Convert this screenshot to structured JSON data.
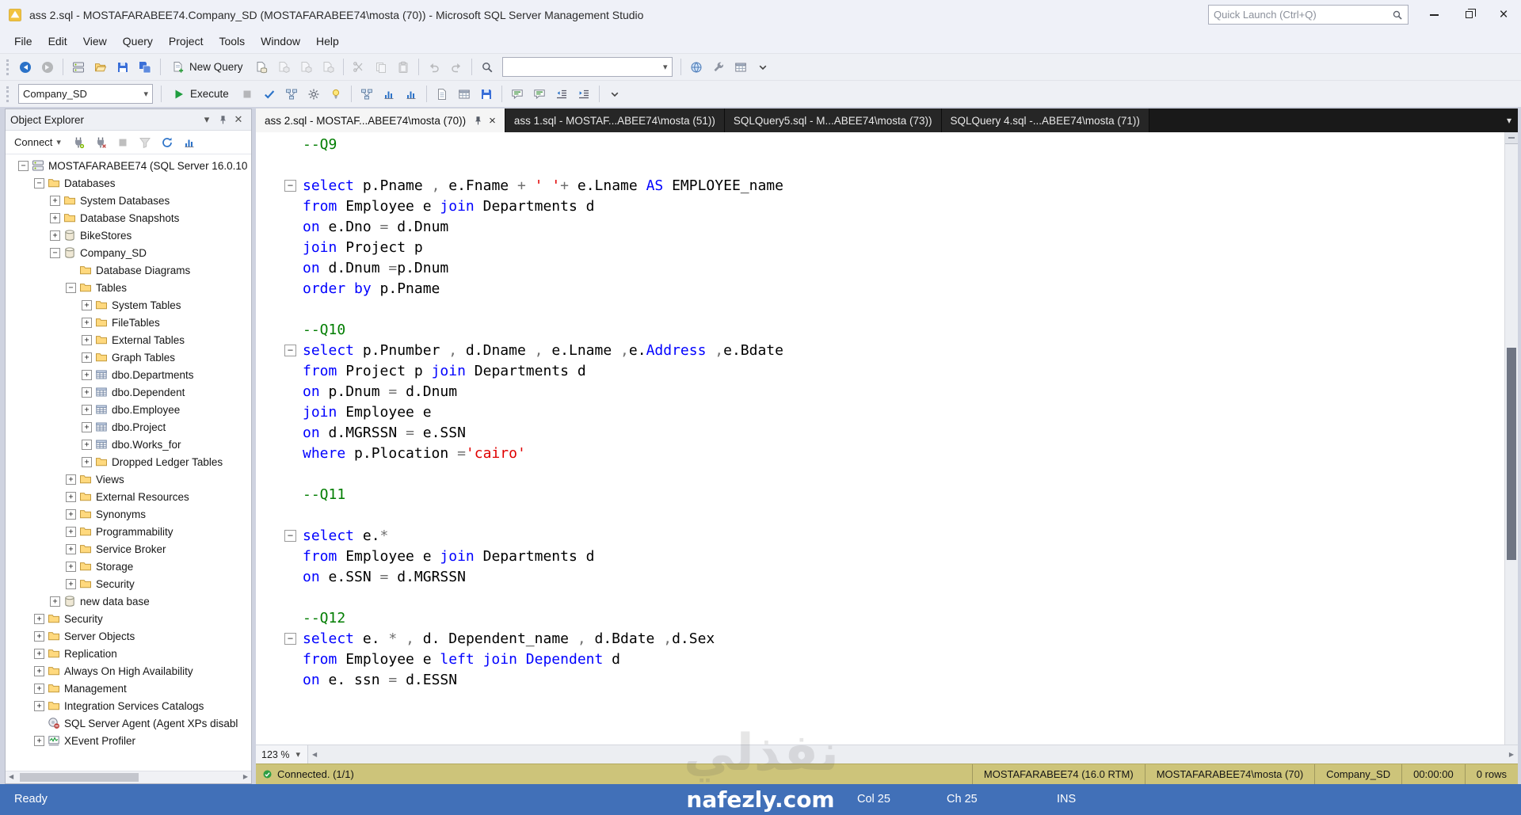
{
  "titlebar": {
    "title": "ass 2.sql - MOSTAFARABEE74.Company_SD (MOSTAFARABEE74\\mosta (70)) - Microsoft SQL Server Management Studio",
    "quick_launch_placeholder": "Quick Launch (Ctrl+Q)"
  },
  "menubar": {
    "items": [
      "File",
      "Edit",
      "View",
      "Query",
      "Project",
      "Tools",
      "Window",
      "Help"
    ]
  },
  "standard_toolbar": {
    "new_query_label": "New Query",
    "items": [
      {
        "t": "i",
        "name": "back-button",
        "icon": "arrow-left-icon",
        "enabled": true
      },
      {
        "t": "i",
        "name": "forward-button",
        "icon": "arrow-right-icon",
        "enabled": false
      },
      {
        "t": "sep"
      },
      {
        "t": "i",
        "name": "manage-connections-icon",
        "icon": "server-icon",
        "enabled": true
      },
      {
        "t": "i",
        "name": "open-file-icon",
        "icon": "folder-open-icon",
        "enabled": true
      },
      {
        "t": "i",
        "name": "save-icon",
        "icon": "floppy-icon",
        "enabled": true
      },
      {
        "t": "i",
        "name": "save-all-icon",
        "icon": "floppy-all-icon",
        "enabled": true
      },
      {
        "t": "sep"
      },
      {
        "t": "btn",
        "name": "new-query-button",
        "icon": "page-plus-icon",
        "labelKey": "new_query_label"
      },
      {
        "t": "i",
        "name": "new-database-engine-query-icon",
        "icon": "page-db-icon",
        "enabled": true
      },
      {
        "t": "i",
        "name": "new-analysis-query-icon",
        "icon": "page-cube-icon",
        "enabled": false
      },
      {
        "t": "i",
        "name": "new-dmx-query-icon",
        "icon": "page-cube-icon",
        "enabled": false
      },
      {
        "t": "i",
        "name": "new-xmla-query-icon",
        "icon": "page-cube-icon",
        "enabled": false
      },
      {
        "t": "sep"
      },
      {
        "t": "i",
        "name": "cut-icon",
        "icon": "scissors-icon",
        "enabled": false
      },
      {
        "t": "i",
        "name": "copy-icon",
        "icon": "copy-icon",
        "enabled": false
      },
      {
        "t": "i",
        "name": "paste-icon",
        "icon": "clipboard-icon",
        "enabled": false
      },
      {
        "t": "sep"
      },
      {
        "t": "i",
        "name": "undo-icon",
        "icon": "undo-icon",
        "enabled": false
      },
      {
        "t": "i",
        "name": "redo-icon",
        "icon": "redo-icon",
        "enabled": false
      },
      {
        "t": "sep"
      },
      {
        "t": "i",
        "name": "find-icon",
        "icon": "magnifier-icon",
        "enabled": true
      },
      {
        "t": "combo",
        "name": "find-combobox",
        "value": ""
      },
      {
        "t": "sep"
      },
      {
        "t": "i",
        "name": "web-browser-icon",
        "icon": "globe-icon",
        "enabled": true
      },
      {
        "t": "i",
        "name": "properties-window-icon",
        "icon": "wrench-icon",
        "enabled": true
      },
      {
        "t": "i",
        "name": "template-explorer-icon",
        "icon": "grid-icon",
        "enabled": true
      },
      {
        "t": "i",
        "name": "toolbar-overflow-chevron",
        "icon": "chevron-down-icon",
        "enabled": true
      }
    ]
  },
  "sql_toolbar": {
    "database_selector_value": "Company_SD",
    "execute_label": "Execute",
    "items": [
      {
        "t": "dbcombo",
        "name": "database-selector"
      },
      {
        "t": "sep"
      },
      {
        "t": "exec",
        "name": "execute-button"
      },
      {
        "t": "i",
        "name": "cancel-query-icon",
        "icon": "stop-icon",
        "enabled": false
      },
      {
        "t": "i",
        "name": "parse-query-icon",
        "icon": "check-icon",
        "enabled": true
      },
      {
        "t": "i",
        "name": "estimated-plan-icon",
        "icon": "plan-icon",
        "enabled": true
      },
      {
        "t": "i",
        "name": "query-options-icon",
        "icon": "gear-icon",
        "enabled": true
      },
      {
        "t": "i",
        "name": "intellisense-icon",
        "icon": "bulb-icon",
        "enabled": true
      },
      {
        "t": "sep"
      },
      {
        "t": "i",
        "name": "actual-plan-icon",
        "icon": "plan-icon",
        "enabled": true
      },
      {
        "t": "i",
        "name": "live-query-stats-icon",
        "icon": "chart-icon",
        "enabled": true
      },
      {
        "t": "i",
        "name": "client-stats-icon",
        "icon": "chart-icon",
        "enabled": true
      },
      {
        "t": "sep"
      },
      {
        "t": "i",
        "name": "results-to-text-icon",
        "icon": "page-icon",
        "enabled": true
      },
      {
        "t": "i",
        "name": "results-to-grid-icon",
        "icon": "grid-icon",
        "enabled": true
      },
      {
        "t": "i",
        "name": "results-to-file-icon",
        "icon": "floppy-icon",
        "enabled": true
      },
      {
        "t": "sep"
      },
      {
        "t": "i",
        "name": "comment-selection-icon",
        "icon": "comment-icon",
        "enabled": true
      },
      {
        "t": "i",
        "name": "uncomment-selection-icon",
        "icon": "comment-icon",
        "enabled": true
      },
      {
        "t": "i",
        "name": "decrease-indent-icon",
        "icon": "indent-dec-icon",
        "enabled": true
      },
      {
        "t": "i",
        "name": "increase-indent-icon",
        "icon": "indent-inc-icon",
        "enabled": true
      },
      {
        "t": "sep"
      },
      {
        "t": "i",
        "name": "toolbar-overflow-chevron",
        "icon": "chevron-down-icon",
        "enabled": true
      }
    ]
  },
  "tab_strip": {
    "tabs": [
      {
        "label": "ass 2.sql - MOSTAF...ABEE74\\mosta (70))",
        "active": true
      },
      {
        "label": "ass 1.sql - MOSTAF...ABEE74\\mosta (51))",
        "active": false
      },
      {
        "label": "SQLQuery5.sql - M...ABEE74\\mosta (73))",
        "active": false
      },
      {
        "label": "SQLQuery 4.sql -...ABEE74\\mosta (71))",
        "active": false
      }
    ]
  },
  "object_explorer": {
    "title": "Object Explorer",
    "connect_label": "Connect",
    "toolbar_icons": [
      {
        "name": "connect-server-icon",
        "icon": "plug-icon",
        "enabled": true
      },
      {
        "name": "disconnect-server-icon",
        "icon": "plug-x-icon",
        "enabled": true
      },
      {
        "name": "stop-icon",
        "icon": "stop-icon",
        "enabled": false
      },
      {
        "name": "filter-icon",
        "icon": "funnel-icon",
        "enabled": false
      },
      {
        "name": "refresh-icon",
        "icon": "refresh-icon",
        "enabled": true
      },
      {
        "name": "activity-monitor-icon",
        "icon": "chart-icon",
        "enabled": true
      }
    ],
    "tree": [
      {
        "label": "MOSTAFARABEE74 (SQL Server 16.0.10",
        "level": 0,
        "exp": "minus",
        "icon": "server"
      },
      {
        "label": "Databases",
        "level": 1,
        "exp": "minus",
        "icon": "folder"
      },
      {
        "label": "System Databases",
        "level": 2,
        "exp": "plus",
        "icon": "folder"
      },
      {
        "label": "Database Snapshots",
        "level": 2,
        "exp": "plus",
        "icon": "folder"
      },
      {
        "label": "BikeStores",
        "level": 2,
        "exp": "plus",
        "icon": "database"
      },
      {
        "label": "Company_SD",
        "level": 2,
        "exp": "minus",
        "icon": "database"
      },
      {
        "label": "Database Diagrams",
        "level": 3,
        "exp": "none",
        "icon": "folder"
      },
      {
        "label": "Tables",
        "level": 3,
        "exp": "minus",
        "icon": "folder"
      },
      {
        "label": "System Tables",
        "level": 4,
        "exp": "plus",
        "icon": "folder"
      },
      {
        "label": "FileTables",
        "level": 4,
        "exp": "plus",
        "icon": "folder"
      },
      {
        "label": "External Tables",
        "level": 4,
        "exp": "plus",
        "icon": "folder"
      },
      {
        "label": "Graph Tables",
        "level": 4,
        "exp": "plus",
        "icon": "folder"
      },
      {
        "label": "dbo.Departments",
        "level": 4,
        "exp": "plus",
        "icon": "table"
      },
      {
        "label": "dbo.Dependent",
        "level": 4,
        "exp": "plus",
        "icon": "table"
      },
      {
        "label": "dbo.Employee",
        "level": 4,
        "exp": "plus",
        "icon": "table"
      },
      {
        "label": "dbo.Project",
        "level": 4,
        "exp": "plus",
        "icon": "table"
      },
      {
        "label": "dbo.Works_for",
        "level": 4,
        "exp": "plus",
        "icon": "table"
      },
      {
        "label": "Dropped Ledger Tables",
        "level": 4,
        "exp": "plus",
        "icon": "folder"
      },
      {
        "label": "Views",
        "level": 3,
        "exp": "plus",
        "icon": "folder"
      },
      {
        "label": "External Resources",
        "level": 3,
        "exp": "plus",
        "icon": "folder"
      },
      {
        "label": "Synonyms",
        "level": 3,
        "exp": "plus",
        "icon": "folder"
      },
      {
        "label": "Programmability",
        "level": 3,
        "exp": "plus",
        "icon": "folder"
      },
      {
        "label": "Service Broker",
        "level": 3,
        "exp": "plus",
        "icon": "folder"
      },
      {
        "label": "Storage",
        "level": 3,
        "exp": "plus",
        "icon": "folder"
      },
      {
        "label": "Security",
        "level": 3,
        "exp": "plus",
        "icon": "folder"
      },
      {
        "label": "new data base",
        "level": 2,
        "exp": "plus",
        "icon": "database"
      },
      {
        "label": "Security",
        "level": 1,
        "exp": "plus",
        "icon": "folder"
      },
      {
        "label": "Server Objects",
        "level": 1,
        "exp": "plus",
        "icon": "folder"
      },
      {
        "label": "Replication",
        "level": 1,
        "exp": "plus",
        "icon": "folder"
      },
      {
        "label": "Always On High Availability",
        "level": 1,
        "exp": "plus",
        "icon": "folder"
      },
      {
        "label": "Management",
        "level": 1,
        "exp": "plus",
        "icon": "folder"
      },
      {
        "label": "Integration Services Catalogs",
        "level": 1,
        "exp": "plus",
        "icon": "folder"
      },
      {
        "label": "SQL Server Agent (Agent XPs disabl",
        "level": 1,
        "exp": "none",
        "icon": "agent"
      },
      {
        "label": "XEvent Profiler",
        "level": 1,
        "exp": "plus",
        "icon": "profiler"
      }
    ]
  },
  "editor": {
    "zoom_value": "123 %",
    "lines": [
      {
        "fold": false,
        "seg": [
          [
            "c",
            "--Q9"
          ]
        ]
      },
      {
        "fold": false,
        "seg": []
      },
      {
        "fold": true,
        "seg": [
          [
            "k",
            "select"
          ],
          [
            "i",
            " p.Pname "
          ],
          [
            "o",
            ","
          ],
          [
            "i",
            " e.Fname "
          ],
          [
            "o",
            "+"
          ],
          [
            "i",
            " "
          ],
          [
            "s",
            "' '"
          ],
          [
            "o",
            "+"
          ],
          [
            "i",
            " e.Lname "
          ],
          [
            "k",
            "AS"
          ],
          [
            "i",
            " EMPLOYEE_name"
          ]
        ]
      },
      {
        "fold": false,
        "seg": [
          [
            "k",
            "from"
          ],
          [
            "i",
            " Employee e "
          ],
          [
            "k",
            "join"
          ],
          [
            "i",
            " Departments d"
          ]
        ]
      },
      {
        "fold": false,
        "seg": [
          [
            "k",
            "on"
          ],
          [
            "i",
            " e.Dno "
          ],
          [
            "o",
            "="
          ],
          [
            "i",
            " d.Dnum"
          ]
        ]
      },
      {
        "fold": false,
        "seg": [
          [
            "k",
            "join"
          ],
          [
            "i",
            " Project p"
          ]
        ]
      },
      {
        "fold": false,
        "seg": [
          [
            "k",
            "on"
          ],
          [
            "i",
            " d.Dnum "
          ],
          [
            "o",
            "="
          ],
          [
            "i",
            "p.Dnum"
          ]
        ]
      },
      {
        "fold": false,
        "seg": [
          [
            "k",
            "order by"
          ],
          [
            "i",
            " p.Pname"
          ]
        ]
      },
      {
        "fold": false,
        "seg": []
      },
      {
        "fold": false,
        "seg": [
          [
            "c",
            "--Q10"
          ]
        ]
      },
      {
        "fold": true,
        "seg": [
          [
            "k",
            "select"
          ],
          [
            "i",
            " p.Pnumber "
          ],
          [
            "o",
            ","
          ],
          [
            "i",
            " d.Dname "
          ],
          [
            "o",
            ","
          ],
          [
            "i",
            " e.Lname "
          ],
          [
            "o",
            ","
          ],
          [
            "i",
            "e."
          ],
          [
            "k",
            "Address"
          ],
          [
            "o",
            " ,"
          ],
          [
            "i",
            "e.Bdate"
          ]
        ]
      },
      {
        "fold": false,
        "seg": [
          [
            "k",
            "from"
          ],
          [
            "i",
            " Project p "
          ],
          [
            "k",
            "join"
          ],
          [
            "i",
            " Departments d"
          ]
        ]
      },
      {
        "fold": false,
        "seg": [
          [
            "k",
            "on"
          ],
          [
            "i",
            " p.Dnum "
          ],
          [
            "o",
            "="
          ],
          [
            "i",
            " d.Dnum"
          ]
        ]
      },
      {
        "fold": false,
        "seg": [
          [
            "k",
            "join"
          ],
          [
            "i",
            " Employee e"
          ]
        ]
      },
      {
        "fold": false,
        "seg": [
          [
            "k",
            "on"
          ],
          [
            "i",
            " d.MGRSSN "
          ],
          [
            "o",
            "="
          ],
          [
            "i",
            " e.SSN"
          ]
        ]
      },
      {
        "fold": false,
        "seg": [
          [
            "k",
            "where"
          ],
          [
            "i",
            " p.Plocation "
          ],
          [
            "o",
            "="
          ],
          [
            "s",
            "'cairo'"
          ]
        ]
      },
      {
        "fold": false,
        "seg": []
      },
      {
        "fold": false,
        "seg": [
          [
            "c",
            "--Q11"
          ]
        ]
      },
      {
        "fold": false,
        "seg": []
      },
      {
        "fold": true,
        "seg": [
          [
            "k",
            "select"
          ],
          [
            "i",
            " e."
          ],
          [
            "o",
            "*"
          ]
        ]
      },
      {
        "fold": false,
        "seg": [
          [
            "k",
            "from"
          ],
          [
            "i",
            " Employee e "
          ],
          [
            "k",
            "join"
          ],
          [
            "i",
            " Departments d"
          ]
        ]
      },
      {
        "fold": false,
        "seg": [
          [
            "k",
            "on"
          ],
          [
            "i",
            " e.SSN "
          ],
          [
            "o",
            "="
          ],
          [
            "i",
            " d.MGRSSN"
          ]
        ]
      },
      {
        "fold": false,
        "seg": []
      },
      {
        "fold": false,
        "seg": [
          [
            "c",
            "--Q12"
          ]
        ]
      },
      {
        "fold": true,
        "seg": [
          [
            "k",
            "select"
          ],
          [
            "i",
            " e. "
          ],
          [
            "o",
            "*"
          ],
          [
            "i",
            " "
          ],
          [
            "o",
            ","
          ],
          [
            "i",
            " d. Dependent_name "
          ],
          [
            "o",
            ","
          ],
          [
            "i",
            " d.Bdate "
          ],
          [
            "o",
            ","
          ],
          [
            "i",
            "d.Sex"
          ]
        ]
      },
      {
        "fold": false,
        "seg": [
          [
            "k",
            "from"
          ],
          [
            "i",
            " Employee e "
          ],
          [
            "k",
            "left join"
          ],
          [
            "i",
            " "
          ],
          [
            "k",
            "Dependent"
          ],
          [
            "i",
            " d"
          ]
        ]
      },
      {
        "fold": false,
        "seg": [
          [
            "k",
            "on"
          ],
          [
            "i",
            " e. ssn "
          ],
          [
            "o",
            "="
          ],
          [
            "i",
            " d.ESSN"
          ]
        ]
      }
    ]
  },
  "connected_bar": {
    "status": "Connected. (1/1)",
    "server": "MOSTAFARABEE74 (16.0 RTM)",
    "login": "MOSTAFARABEE74\\mosta (70)",
    "database": "Company_SD",
    "duration": "00:00:00",
    "rows": "0 rows"
  },
  "statusbar": {
    "state": "Ready",
    "col": "Col 25",
    "ch": "Ch 25",
    "mode": "INS"
  },
  "watermark": {
    "site": "nafezly.com",
    "arabic": "نفذلي"
  },
  "colors": {
    "keyword": "#0000ff",
    "comment": "#007d00",
    "string": "#e00000",
    "operator": "#707070",
    "identifier": "#000000",
    "statusbar-bg": "#4170b8",
    "connected-bg": "#cdc47a",
    "tabstrip-bg": "#191919"
  }
}
